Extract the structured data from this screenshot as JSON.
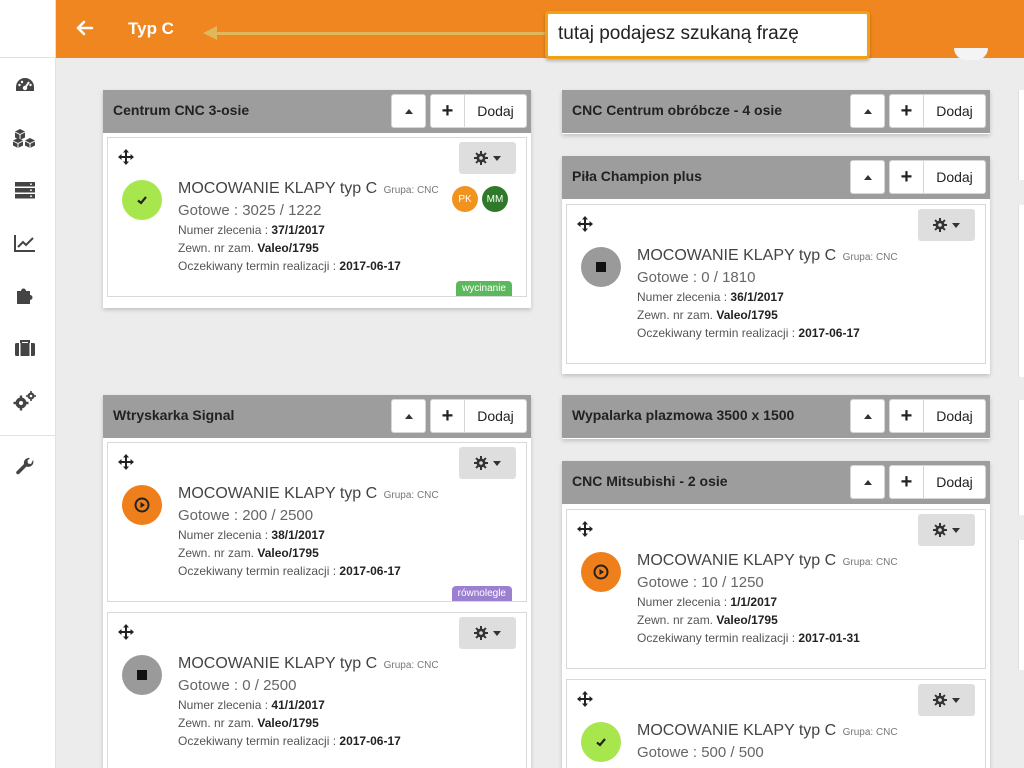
{
  "topbar": {
    "search_value": "Typ C",
    "callout_text": "tutaj podajesz szukaną frazę",
    "back_icon": "arrow-left-icon"
  },
  "sidebar": {
    "items": [
      {
        "icon": "dashboard-icon"
      },
      {
        "icon": "cubes-icon"
      },
      {
        "icon": "server-icon"
      },
      {
        "icon": "line-chart-icon"
      },
      {
        "icon": "puzzle-icon"
      },
      {
        "icon": "briefcase-icon"
      },
      {
        "icon": "gears-icon"
      },
      {
        "icon": "wrench-icon"
      }
    ]
  },
  "labels": {
    "add": "Dodaj",
    "plus": "+",
    "group_label": "Grupa: CNC",
    "order_label": "Numer zlecenia",
    "ext_label": "Zewn. nr zam.",
    "deadline_label": "Oczekiwany termin realizacji",
    "ready_label": "Gotowe"
  },
  "colors": {
    "accent": "#ef861f",
    "done": "#a8e64d",
    "running": "#ef7f1a",
    "stopped": "#9a9a9a",
    "tag_cut": "#5cb85c",
    "tag_parallel": "#9b7fd0"
  },
  "panels": [
    {
      "title": "Centrum CNC 3-osie",
      "cards": [
        {
          "title": "MOCOWANIE KLAPY typ C",
          "progress": "3025 / 1222",
          "order": "37/1/2017",
          "ext": "Valeo/1795",
          "deadline": "2017-06-17",
          "status": "done",
          "badges": [
            "PK",
            "MM"
          ],
          "tag": "wycinanie"
        }
      ]
    },
    {
      "title": "CNC Centrum obróbcze - 4 osie",
      "cards": []
    },
    {
      "title": "Piła Champion plus",
      "cards": [
        {
          "title": "MOCOWANIE KLAPY typ C",
          "progress": "0 / 1810",
          "order": "36/1/2017",
          "ext": "Valeo/1795",
          "deadline": "2017-06-17",
          "status": "stopped"
        }
      ]
    },
    {
      "title": "Wtryskarka Signal",
      "cards": [
        {
          "title": "MOCOWANIE KLAPY typ C",
          "progress": "200 / 2500",
          "order": "38/1/2017",
          "ext": "Valeo/1795",
          "deadline": "2017-06-17",
          "status": "running",
          "tag": "równolegle"
        },
        {
          "title": "MOCOWANIE KLAPY typ C",
          "progress": "0 / 2500",
          "order": "41/1/2017",
          "ext": "Valeo/1795",
          "deadline": "2017-06-17",
          "status": "stopped"
        }
      ]
    },
    {
      "title": "Wypalarka plazmowa 3500 x 1500",
      "cards": []
    },
    {
      "title": "CNC Mitsubishi - 2 osie",
      "cards": [
        {
          "title": "MOCOWANIE KLAPY typ C",
          "progress": "10 / 1250",
          "order": "1/1/2017",
          "ext": "Valeo/1795",
          "deadline": "2017-01-31",
          "status": "running"
        },
        {
          "title": "MOCOWANIE KLAPY typ C",
          "progress": "500 / 500",
          "status": "done"
        }
      ]
    }
  ]
}
